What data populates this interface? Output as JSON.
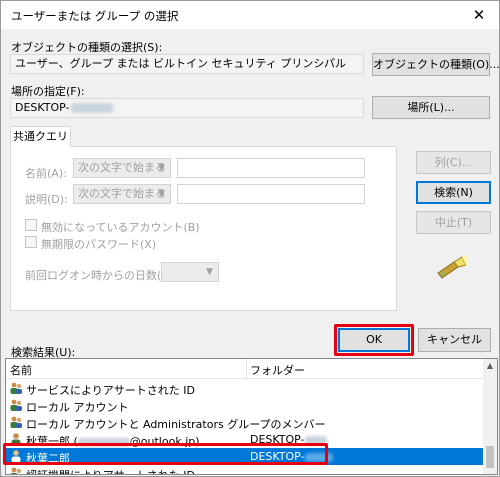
{
  "window": {
    "title": "ユーザーまたは グループ の選択"
  },
  "object_types": {
    "label": "オブジェクトの種類の選択(S):",
    "value": "ユーザー、グループ または ビルトイン セキュリティ プリンシパル",
    "button": "オブジェクトの種類(O)..."
  },
  "location": {
    "label": "場所の指定(F):",
    "value": "DESKTOP-",
    "button": "場所(L)..."
  },
  "common_query": {
    "tab": "共通クエリ",
    "name_label": "名前(A):",
    "name_op": "次の文字で始まる",
    "desc_label": "説明(D):",
    "desc_op": "次の文字で始まる",
    "disabled_accounts": "無効になっているアカウント(B)",
    "no_expire_pw": "無期限のパスワード(X)",
    "days_label": "前回ログオン時からの日数(I):"
  },
  "side_buttons": {
    "columns": "列(C)...",
    "search": "検索(N)",
    "stop": "中止(T)"
  },
  "ok": "OK",
  "cancel": "キャンセル",
  "results": {
    "label": "検索結果(U):",
    "columns": [
      "名前",
      "フォルダー"
    ],
    "rows": [
      {
        "name": "サービスによりアサートされた ID",
        "folder": ""
      },
      {
        "name": "ローカル アカウント",
        "folder": ""
      },
      {
        "name": "ローカル アカウントと Administrators グループのメンバー",
        "folder": ""
      },
      {
        "name": "秋葉一郎 (",
        "name_suffix": "@outlook.jp)",
        "folder": "DESKTOP-"
      },
      {
        "name": "秋葉二郎",
        "folder": "DESKTOP-"
      },
      {
        "name": "認証機関によりアサートされた ID",
        "folder": ""
      }
    ]
  }
}
